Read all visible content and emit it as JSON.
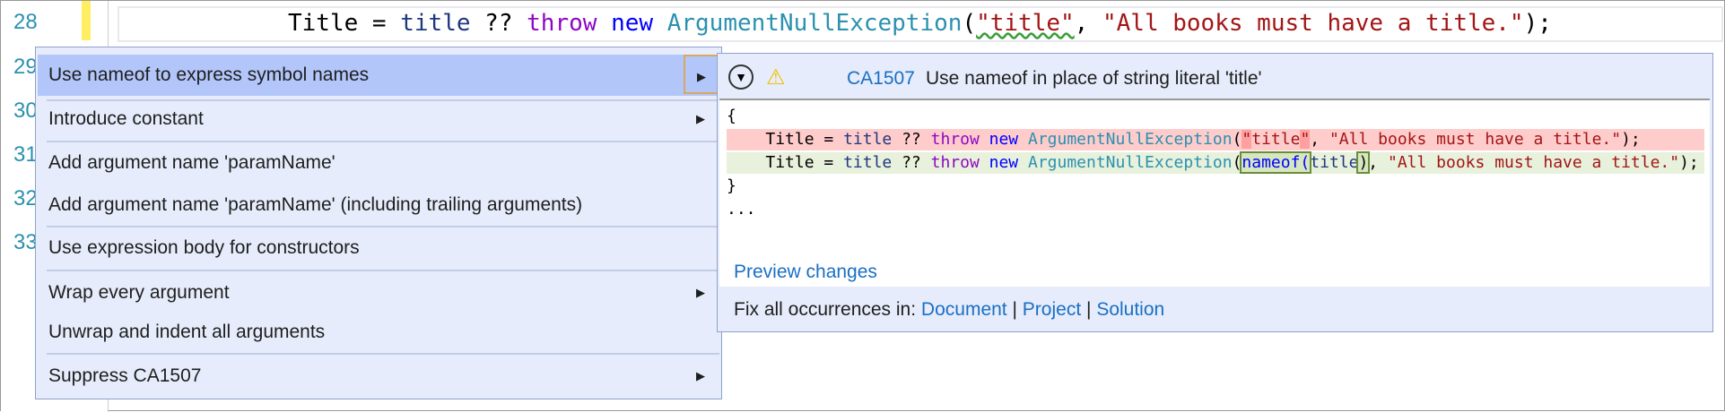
{
  "editor": {
    "line_numbers": [
      "28",
      "29",
      "30",
      "31",
      "32",
      "33"
    ],
    "code_line": {
      "pre": "Title = ",
      "id": "title",
      "op": " ?? ",
      "throw": "throw",
      "new": " new ",
      "type": "ArgumentNullException",
      "open": "(",
      "arg": "\"title\"",
      "comma": ", ",
      "msg": "\"All books must have a title.\"",
      "close": ");"
    }
  },
  "menu": {
    "items": [
      {
        "label": "Use nameof to express symbol names",
        "submenu": true,
        "selected": true
      },
      {
        "label": "Introduce constant",
        "submenu": true
      },
      {
        "label": "Add argument name 'paramName'"
      },
      {
        "label": "Add argument name 'paramName' (including trailing arguments)"
      },
      {
        "label": "Use expression body for constructors"
      },
      {
        "label": "Wrap every argument",
        "submenu": true
      },
      {
        "label": "Unwrap and indent all arguments"
      },
      {
        "label": "Suppress CA1507",
        "submenu": true
      }
    ]
  },
  "preview": {
    "rule_id": "CA1507",
    "message": "Use nameof in place of string literal 'title'",
    "open_brace": "{",
    "close_brace": "}",
    "ellipsis": "...",
    "preview_changes": "Preview changes",
    "fix_all": "Fix all occurrences in:",
    "scopes": [
      "Document",
      "Project",
      "Solution"
    ],
    "sep": "|",
    "icons": {
      "collapse": "chevron-circle-down-icon",
      "warning": "warning-triangle-icon"
    }
  }
}
